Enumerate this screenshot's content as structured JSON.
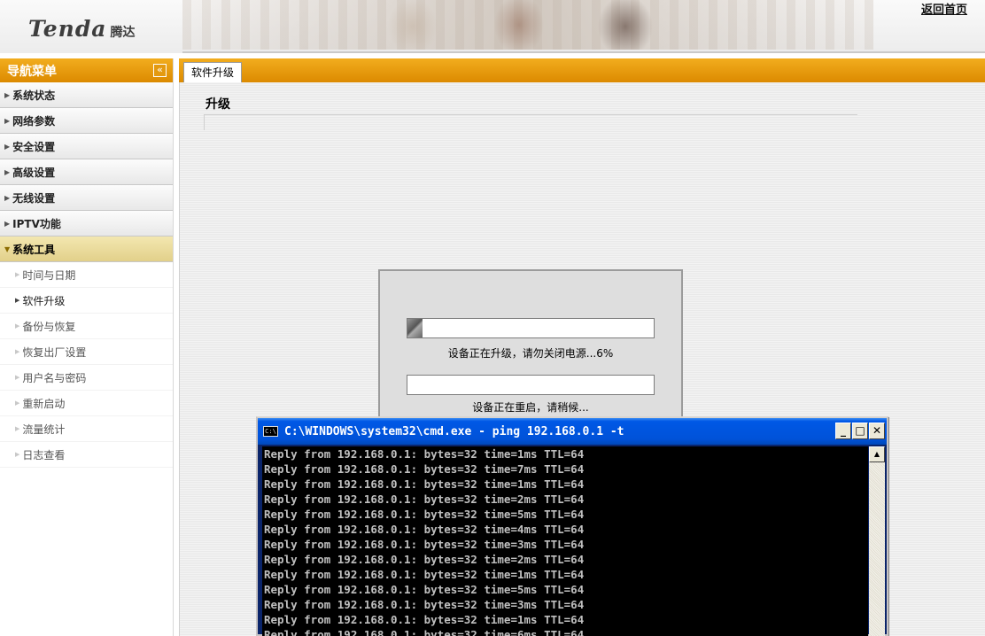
{
  "header": {
    "logo_en": "Tenda",
    "logo_cn": "腾达",
    "home_link": "返回首页"
  },
  "sidebar": {
    "title": "导航菜单",
    "collapse_glyph": "«",
    "menu": [
      {
        "label": "系统状态"
      },
      {
        "label": "网络参数"
      },
      {
        "label": "安全设置"
      },
      {
        "label": "高级设置"
      },
      {
        "label": "无线设置"
      },
      {
        "label": "IPTV功能"
      },
      {
        "label": "系统工具",
        "expanded": true
      }
    ],
    "submenu": [
      {
        "label": "时间与日期"
      },
      {
        "label": "软件升级",
        "current": true
      },
      {
        "label": "备份与恢复"
      },
      {
        "label": "恢复出厂设置"
      },
      {
        "label": "用户名与密码"
      },
      {
        "label": "重新启动"
      },
      {
        "label": "流量统计"
      },
      {
        "label": "日志查看"
      }
    ]
  },
  "main": {
    "tab_label": "软件升级",
    "section_title": "升级"
  },
  "upgrade_dialog": {
    "upgrade_progress_fraction": 0.06,
    "upgrade_label": "设备正在升级，请勿关闭电源...6%",
    "reboot_progress_fraction": 0,
    "reboot_label": "设备正在重启，请稍候..."
  },
  "cmd": {
    "icon_text": "C:\\",
    "title": "C:\\WINDOWS\\system32\\cmd.exe - ping 192.168.0.1 -t",
    "lines": [
      "Reply from 192.168.0.1: bytes=32 time=1ms TTL=64",
      "Reply from 192.168.0.1: bytes=32 time=7ms TTL=64",
      "Reply from 192.168.0.1: bytes=32 time=1ms TTL=64",
      "Reply from 192.168.0.1: bytes=32 time=2ms TTL=64",
      "Reply from 192.168.0.1: bytes=32 time=5ms TTL=64",
      "Reply from 192.168.0.1: bytes=32 time=4ms TTL=64",
      "Reply from 192.168.0.1: bytes=32 time=3ms TTL=64",
      "Reply from 192.168.0.1: bytes=32 time=2ms TTL=64",
      "Reply from 192.168.0.1: bytes=32 time=1ms TTL=64",
      "Reply from 192.168.0.1: bytes=32 time=5ms TTL=64",
      "Reply from 192.168.0.1: bytes=32 time=3ms TTL=64",
      "Reply from 192.168.0.1: bytes=32 time=1ms TTL=64",
      "Reply from 192.168.0.1: bytes=32 time=6ms TTL=64"
    ],
    "minimize_glyph": "_",
    "maximize_glyph": "□",
    "close_glyph": "✕",
    "scroll_up_glyph": "▲"
  },
  "colors": {
    "accent_orange": "#e89a10",
    "cmd_titlebar_blue": "#0054e3"
  }
}
